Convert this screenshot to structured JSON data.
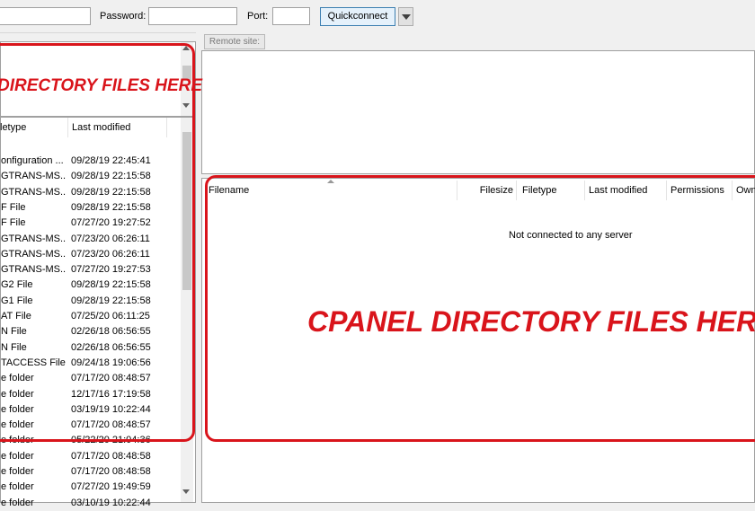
{
  "quickconnect": {
    "host_value": "",
    "password_label": "Password:",
    "password_value": "",
    "port_label": "Port:",
    "port_value": "",
    "quickconnect_button": "Quickconnect"
  },
  "local": {
    "annotation": "DIRECTORY FILES HERE",
    "columns": {
      "filetype": "letype",
      "last_modified": "Last modified"
    },
    "rows": [
      {
        "type": "onfiguration ...",
        "modified": "09/28/19 22:45:41"
      },
      {
        "type": "GTRANS-MS...",
        "modified": "09/28/19 22:15:58"
      },
      {
        "type": "GTRANS-MS...",
        "modified": "09/28/19 22:15:58"
      },
      {
        "type": "F File",
        "modified": "09/28/19 22:15:58"
      },
      {
        "type": "F File",
        "modified": "07/27/20 19:27:52"
      },
      {
        "type": "GTRANS-MS...",
        "modified": "07/23/20 06:26:11"
      },
      {
        "type": "GTRANS-MS...",
        "modified": "07/23/20 06:26:11"
      },
      {
        "type": "GTRANS-MS...",
        "modified": "07/27/20 19:27:53"
      },
      {
        "type": "G2 File",
        "modified": "09/28/19 22:15:58"
      },
      {
        "type": "G1 File",
        "modified": "09/28/19 22:15:58"
      },
      {
        "type": "AT File",
        "modified": "07/25/20 06:11:25"
      },
      {
        "type": "N File",
        "modified": "02/26/18 06:56:55"
      },
      {
        "type": "N File",
        "modified": "02/26/18 06:56:55"
      },
      {
        "type": "TACCESS File",
        "modified": "09/24/18 19:06:56"
      },
      {
        "type": "e folder",
        "modified": "07/17/20 08:48:57"
      },
      {
        "type": "e folder",
        "modified": "12/17/16 17:19:58"
      },
      {
        "type": "e folder",
        "modified": "03/19/19 10:22:44"
      },
      {
        "type": "e folder",
        "modified": "07/17/20 08:48:57"
      },
      {
        "type": "e folder",
        "modified": "05/22/20 21:04:36"
      },
      {
        "type": "e folder",
        "modified": "07/17/20 08:48:58"
      },
      {
        "type": "e folder",
        "modified": "07/17/20 08:48:58"
      },
      {
        "type": "e folder",
        "modified": "07/27/20 19:49:59"
      },
      {
        "type": "e folder",
        "modified": "03/10/19 10:22:44"
      }
    ]
  },
  "remote": {
    "site_label": "Remote site:",
    "columns": {
      "filename": "Filename",
      "filesize": "Filesize",
      "filetype": "Filetype",
      "last_modified": "Last modified",
      "permissions": "Permissions",
      "owner": "Own"
    },
    "status": "Not connected to any server",
    "annotation": "CPANEL DIRECTORY FILES HERE"
  },
  "colors": {
    "annotation": "#d9141b",
    "quickconnect_border": "#3c7fb1"
  },
  "icons": [
    "dropdown-arrow-icon",
    "scroll-up-arrow-icon",
    "scroll-down-arrow-icon",
    "sort-arrow-icon"
  ]
}
